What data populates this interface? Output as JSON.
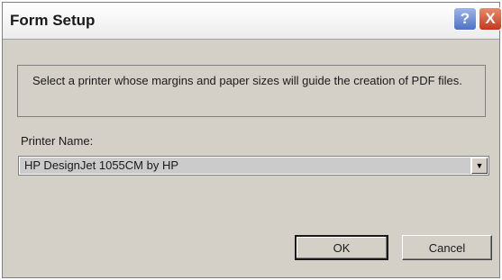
{
  "window": {
    "title": "Form Setup",
    "help_label": "?",
    "close_label": "X"
  },
  "info": {
    "message": "Select a printer whose margins and paper sizes will guide the creation of PDF files."
  },
  "printer": {
    "label": "Printer Name:",
    "selected": "HP DesignJet 1055CM by HP",
    "dropdown_icon": "chevron-down-icon"
  },
  "buttons": {
    "ok": "OK",
    "cancel": "Cancel"
  }
}
